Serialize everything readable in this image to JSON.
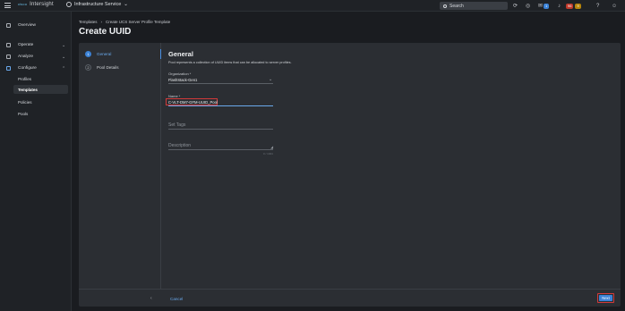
{
  "app": {
    "brand_small": "cisco",
    "brand": "Intersight",
    "service": "Infrastructure Service"
  },
  "search": {
    "label": "Search"
  },
  "topbar": {
    "notify_count": "1",
    "alert_red": "96",
    "alert_yellow": "9"
  },
  "sidebar": {
    "overview": "Overview",
    "operate": "Operate",
    "analyze": "Analyze",
    "configure": "Configure",
    "sub": [
      "Profiles",
      "Templates",
      "Policies",
      "Pools"
    ]
  },
  "breadcrumb": [
    "Templates",
    "Create UCS Server Profile Template"
  ],
  "page_title": "Create UUID",
  "steps": [
    {
      "num": "1",
      "label": "General"
    },
    {
      "num": "2",
      "label": "Pool Details"
    }
  ],
  "form": {
    "title": "General",
    "description": "Pool represents a collection of UUID items that can be allocated to server profiles.",
    "org_label": "Organization *",
    "org_value": "FlashStack-Gen1",
    "name_label": "Name *",
    "name_value": "C-VLT-DM7-GFM-UUID_Pool",
    "tags_placeholder": "Set Tags",
    "desc_placeholder": "Description",
    "desc_counter": "0 / 1024"
  },
  "footer": {
    "cancel": "Cancel",
    "next": "Next"
  },
  "colors": {
    "accent": "#3b82d6",
    "highlight": "#d23a3a",
    "bg": "#1a1c20"
  }
}
